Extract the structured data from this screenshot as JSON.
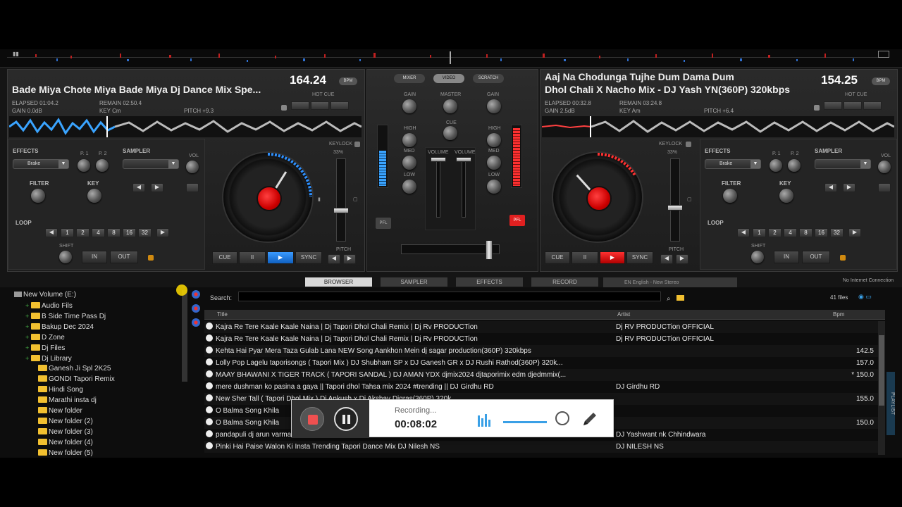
{
  "deck_left": {
    "title": "Bade Miya Chote Miya Bade Miya Dj Dance Mix Spe...",
    "bpm": "164.24",
    "bpm_tag": "BPM",
    "elapsed": "ELAPSED 01:04.2",
    "remain": "REMAIN 02:50.4",
    "gain": "GAIN 0.0dB",
    "key": "KEY Cm",
    "pitch": "PITCH +9.3",
    "hot_cue": "HOT CUE",
    "effects": "EFFECTS",
    "effect_value": "Brake",
    "p1": "P. 1",
    "p2": "P. 2",
    "sampler": "SAMPLER",
    "vol": "VOL",
    "filter": "FILTER",
    "key_label": "KEY",
    "loop": "LOOP",
    "loop_sizes": [
      "1",
      "2",
      "4",
      "8",
      "16",
      "32"
    ],
    "shift": "SHIFT",
    "in": "IN",
    "out": "OUT",
    "keylock": "KEYLOCK",
    "keylock_pct": "33%",
    "pitch_label": "PITCH",
    "cue": "CUE",
    "pause": "II",
    "sync": "SYNC"
  },
  "deck_right": {
    "title": "Aaj Na Chodunga Tujhe Dum Dama Dum",
    "subtitle": "Dhol Chali X Nacho Mix - DJ Yash YN(360P) 320kbps",
    "bpm": "154.25",
    "bpm_tag": "BPM",
    "elapsed": "ELAPSED 00:32.8",
    "remain": "REMAIN 03:24.8",
    "gain": "GAIN 2.5dB",
    "key": "KEY Am",
    "pitch": "PITCH +6.4",
    "hot_cue": "HOT CUE",
    "effects": "EFFECTS",
    "effect_value": "Brake",
    "p1": "P. 1",
    "p2": "P. 2",
    "sampler": "SAMPLER",
    "vol": "VOL",
    "filter": "FILTER",
    "key_label": "KEY",
    "loop": "LOOP",
    "loop_sizes": [
      "1",
      "2",
      "4",
      "8",
      "16",
      "32"
    ],
    "shift": "SHIFT",
    "in": "IN",
    "out": "OUT",
    "keylock": "KEYLOCK",
    "keylock_pct": "33%",
    "pitch_label": "PITCH",
    "cue": "CUE",
    "pause": "II",
    "sync": "SYNC",
    "tooltip": "EN English - New Stereo"
  },
  "mixer": {
    "tabs": [
      "MIXER",
      "VIDEO",
      "SCRATCH"
    ],
    "gain": "GAIN",
    "master": "MASTER",
    "cue": "CUE",
    "high": "HIGH",
    "med": "MED",
    "low": "LOW",
    "volume": "VOLUME",
    "pfl": "PFL"
  },
  "browser_tabs": [
    "BROWSER",
    "SAMPLER",
    "EFFECTS",
    "RECORD"
  ],
  "connection_status": "No Internet Connection",
  "tree": [
    {
      "label": "New Volume (E:)",
      "type": "drive",
      "indent": 0
    },
    {
      "label": "Audio Fils",
      "type": "folder",
      "indent": 1
    },
    {
      "label": "B Side Time Pass Dj",
      "type": "folder",
      "indent": 1
    },
    {
      "label": "Bakup Dec 2024",
      "type": "folder",
      "indent": 1
    },
    {
      "label": "D Zone",
      "type": "folder",
      "indent": 1
    },
    {
      "label": "Dj Files",
      "type": "folder",
      "indent": 1
    },
    {
      "label": "Dj Library",
      "type": "folder",
      "indent": 1
    },
    {
      "label": "Ganesh Ji Spl 2K25",
      "type": "folder",
      "indent": 2
    },
    {
      "label": "GONDI Tapori Remix",
      "type": "folder",
      "indent": 2
    },
    {
      "label": "Hindi Song",
      "type": "folder",
      "indent": 2
    },
    {
      "label": "Marathi insta dj",
      "type": "folder",
      "indent": 2
    },
    {
      "label": "New folder",
      "type": "folder",
      "indent": 2
    },
    {
      "label": "New folder (2)",
      "type": "folder",
      "indent": 2
    },
    {
      "label": "New folder (3)",
      "type": "folder",
      "indent": 2
    },
    {
      "label": "New folder (4)",
      "type": "folder",
      "indent": 2
    },
    {
      "label": "New folder (5)",
      "type": "folder",
      "indent": 2
    }
  ],
  "search": {
    "label": "Search:",
    "value": ""
  },
  "file_count": "41 files",
  "columns": {
    "title": "Title",
    "artist": "Artist",
    "bpm": "Bpm"
  },
  "rows": [
    {
      "title": "Kajra Re Tere Kaale Kaale Naina | Dj Tapori Dhol Chali Remix | Dj Rv PRODUCTion",
      "artist": "Dj RV PRODUCTion OFFICIAL",
      "bpm": ""
    },
    {
      "title": "Kajra Re Tere Kaale Kaale Naina | Dj Tapori Dhol Chali Remix | Dj Rv PRODUCTion",
      "artist": "Dj RV PRODUCTion OFFICIAL",
      "bpm": ""
    },
    {
      "title": "Kehta Hai Pyar Mera Taza Gulab Lana NEW Song Aankhon Mein dj sagar production(360P) 320kbps",
      "artist": "",
      "bpm": "142.5"
    },
    {
      "title": "Lolly Pop Lagelu taporisongs ( Tapori Mix ) DJ Shubham SP x DJ Ganesh GR x DJ Rushi Rathod(360P) 320k...",
      "artist": "",
      "bpm": "157.0"
    },
    {
      "title": "MAAY BHAWANI X TIGER TRACK ( TAPORI SANDAL ) DJ AMAN YDX djmix2024 djtaporimix edm djedmmix(...",
      "artist": "",
      "bpm": "* 150.0"
    },
    {
      "title": "mere dushman ko pasina a gaya || Tapori dhol Tahsa mix 2024 #trending || DJ Girdhu RD",
      "artist": "DJ Girdhu RD",
      "bpm": ""
    },
    {
      "title": "New Sher Tall ( Tapori Dhol Mix ) Dj Ankush x Dj Akshay Digras(360P) 320k...",
      "artist": "",
      "bpm": "155.0"
    },
    {
      "title": "O Balma Song Khila",
      "artist": "",
      "bpm": ""
    },
    {
      "title": "O Balma Song Khila",
      "artist": "",
      "bpm": "150.0"
    },
    {
      "title": "pandapuli dj arun varma Remix || dj yashwant nk Chhindwara",
      "artist": "DJ Yashwant nk Chhindwara",
      "bpm": ""
    },
    {
      "title": "Pinki Hai Paise Walon Ki Insta Trending Tapori Dance Mix DJ Nilesh NS",
      "artist": "DJ NILESH NS",
      "bpm": ""
    }
  ],
  "playlist_tab": "PLAYLIST",
  "recorder": {
    "status": "Recording...",
    "time": "00:08:02"
  },
  "colors": {
    "accent_blue": "#1e88e5",
    "accent_red": "#e53030",
    "folder": "#f2c030"
  }
}
